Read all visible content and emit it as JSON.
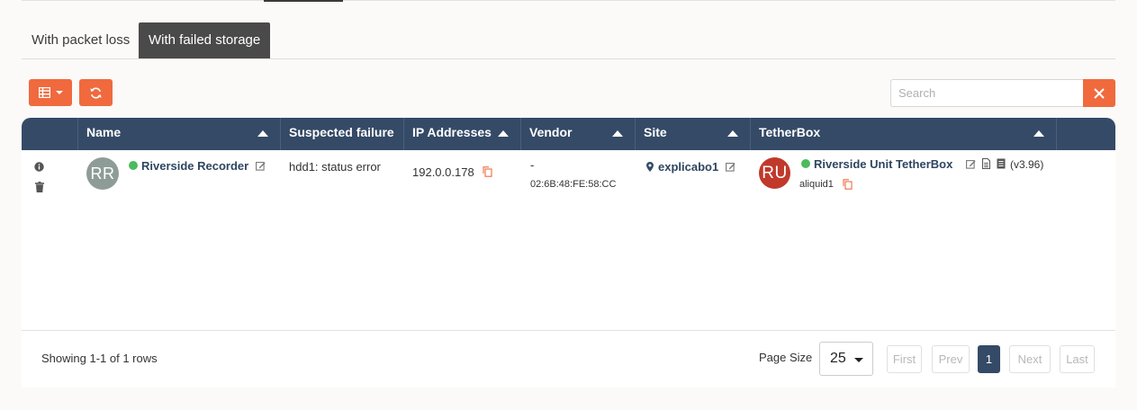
{
  "tabs": [
    {
      "label": "With packet loss",
      "active": false
    },
    {
      "label": "With failed storage",
      "active": true
    }
  ],
  "toolbar": {
    "columns_icon": "table-icon",
    "refresh_icon": "refresh-icon",
    "search_placeholder": "Search",
    "search_value": "",
    "clear_icon": "close-icon",
    "accent_color": "#f06a3e"
  },
  "table": {
    "header_color": "#344a66",
    "columns": [
      "Name",
      "Suspected failure",
      "IP Addresses",
      "Vendor",
      "Site",
      "TetherBox"
    ],
    "rows": [
      {
        "actions": [
          "info-icon",
          "trash-icon"
        ],
        "avatar": "RR",
        "avatar_color": "#8e9c98",
        "status_color": "#4cbb5e",
        "name": "Riverside Recorder",
        "suspected_failure": "hdd1: status error",
        "ip": "192.0.0.178",
        "vendor": "-",
        "mac": "02:6B:48:FE:58:CC",
        "site": "explicabo1",
        "tetherbox": {
          "avatar": "RU",
          "avatar_color": "#c0392b",
          "name": "Riverside Unit TetherBox",
          "version": "(v3.96)",
          "user": "aliquid1"
        }
      }
    ]
  },
  "footer": {
    "showing": "Showing 1-1 of 1 rows",
    "page_size_label": "Page Size",
    "page_size": "25",
    "pagination": {
      "first": "First",
      "prev": "Prev",
      "current": "1",
      "next": "Next",
      "last": "Last"
    }
  }
}
